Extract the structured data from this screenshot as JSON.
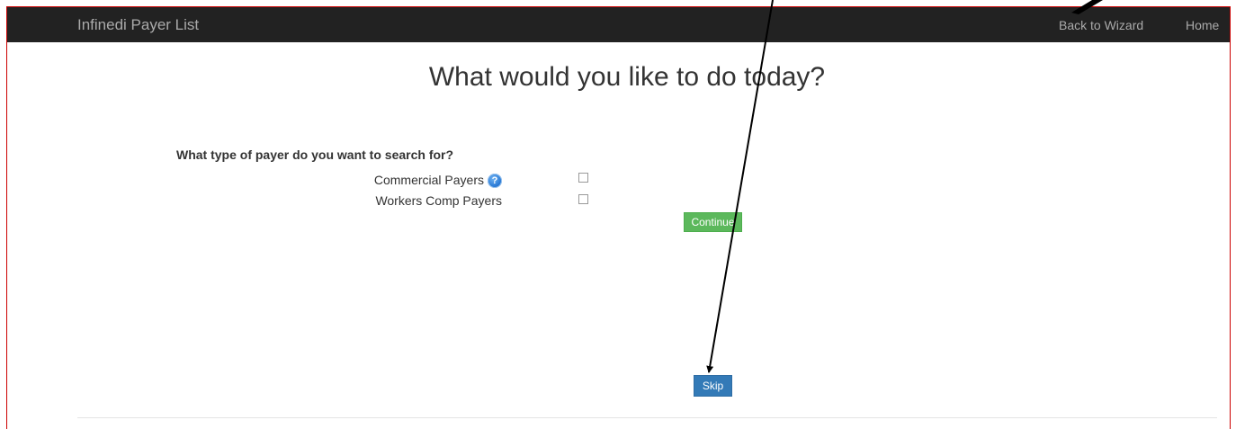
{
  "navbar": {
    "brand": "Infinedi Payer List",
    "links": [
      {
        "label": "Back to Wizard"
      },
      {
        "label": "Home"
      }
    ]
  },
  "main": {
    "heading": "What would you like to do today?",
    "question": "What type of payer do you want to search for?",
    "options": [
      {
        "label": "Commercial Payers",
        "checked": false,
        "has_help_icon": true
      },
      {
        "label": "Workers Comp Payers",
        "checked": false,
        "has_help_icon": false
      }
    ],
    "continue_label": "Continue",
    "skip_label": "Skip"
  },
  "colors": {
    "navbar_bg": "#222222",
    "continue_bg": "#5cb85c",
    "skip_bg": "#337ab7",
    "frame_border": "#cc0000",
    "annotation_arrow": "#000000"
  },
  "icons": {
    "help": "help-circle-icon"
  }
}
